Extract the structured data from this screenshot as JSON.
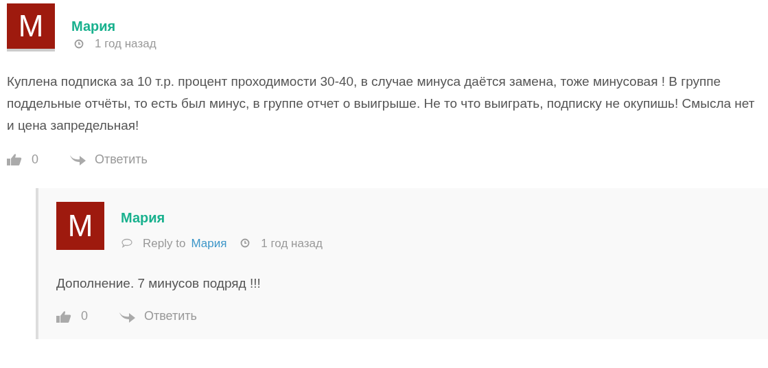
{
  "comments": [
    {
      "avatar": "M",
      "author": "Мария",
      "time": "1 год назад",
      "body": "Куплена подписка за 10 т.р. процент проходимости 30-40, в случае минуса даётся замена, тоже минусовая ! В группе поддельные отчёты, то есть был минус, в группе отчет о выигрыше. Не то что выиграть, подписку не окупишь! Смысла нет и цена запредельная!",
      "likes": "0",
      "reply": "Ответить",
      "children": [
        {
          "avatar": "M",
          "author": "Мария",
          "reply_to_label": "Reply to",
          "reply_to": "Мария",
          "time": "1 год назад",
          "body": "Дополнение. 7 минусов подряд !!!",
          "likes": "0",
          "reply": "Ответить"
        }
      ]
    }
  ]
}
